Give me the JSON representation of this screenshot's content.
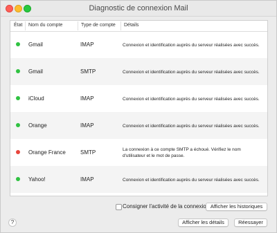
{
  "window": {
    "title": "Diagnostic de connexion Mail"
  },
  "table": {
    "headers": {
      "status": "État",
      "account": "Nom du compte",
      "type": "Type de compte",
      "details": "Détails"
    },
    "rows": [
      {
        "status_color": "#2fc241",
        "account": "Gmail",
        "type": "IMAP",
        "details": "Connexion et identification auprès du serveur réalisées avec succès."
      },
      {
        "status_color": "#2fc241",
        "account": "Gmail",
        "type": "SMTP",
        "details": "Connexion et identification auprès du serveur réalisées avec succès."
      },
      {
        "status_color": "#2fc241",
        "account": "iCloud",
        "type": "IMAP",
        "details": "Connexion et identification auprès du serveur réalisées avec succès."
      },
      {
        "status_color": "#2fc241",
        "account": "Orange",
        "type": "IMAP",
        "details": "Connexion et identification auprès du serveur réalisées avec succès."
      },
      {
        "status_color": "#e8453c",
        "account": "Orange France",
        "type": "SMTP",
        "details": "La connexion à ce compte SMTP a échoué. Vérifiez le nom d'utilisateur et le mot de passe."
      },
      {
        "status_color": "#2fc241",
        "account": "Yahoo!",
        "type": "IMAP",
        "details": "Connexion et identification auprès du serveur réalisées avec succès."
      }
    ]
  },
  "footer": {
    "log_checkbox_label": "Consigner l'activité de la connexion",
    "log_checkbox_checked": false,
    "show_logs_label": "Afficher les historiques",
    "show_details_label": "Afficher les détails",
    "retry_label": "Réessayer",
    "help_label": "?"
  }
}
